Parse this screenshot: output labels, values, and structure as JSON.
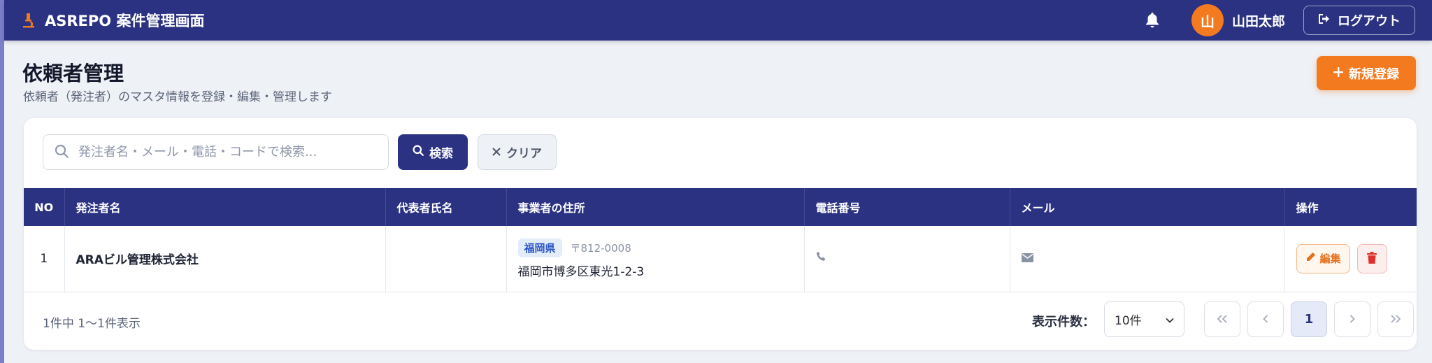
{
  "header": {
    "brand_title": "ASREPO 案件管理画面",
    "user_initial": "山",
    "user_name": "山田太郎",
    "logout_label": "ログアウト",
    "accent_color": "#2c3282",
    "brand_icon": "microscope-icon"
  },
  "page": {
    "title": "依頼者管理",
    "subtitle": "依頼者（発注者）のマスタ情報を登録・編集・管理します",
    "new_button_label": "新規登録",
    "action_color": "#f47a1f"
  },
  "search": {
    "placeholder": "発注者名・メール・電話・コードで検索...",
    "value": "",
    "search_label": "検索",
    "clear_label": "クリア"
  },
  "table": {
    "columns": [
      "NO",
      "発注者名",
      "代表者氏名",
      "事業者の住所",
      "電話番号",
      "メール",
      "操作"
    ],
    "rows": [
      {
        "no": "1",
        "name": "ARAビル管理株式会社",
        "representative": "",
        "prefecture": "福岡県",
        "zip": "〒812-0008",
        "address": "福岡市博多区東光1-2-3",
        "phone_icon": "phone-icon",
        "mail_icon": "envelope-icon",
        "edit_label": "編集"
      }
    ]
  },
  "footer": {
    "summary": "1件中 1〜1件表示",
    "per_page_label": "表示件数：",
    "per_page_value": "10件",
    "current_page": "1"
  }
}
